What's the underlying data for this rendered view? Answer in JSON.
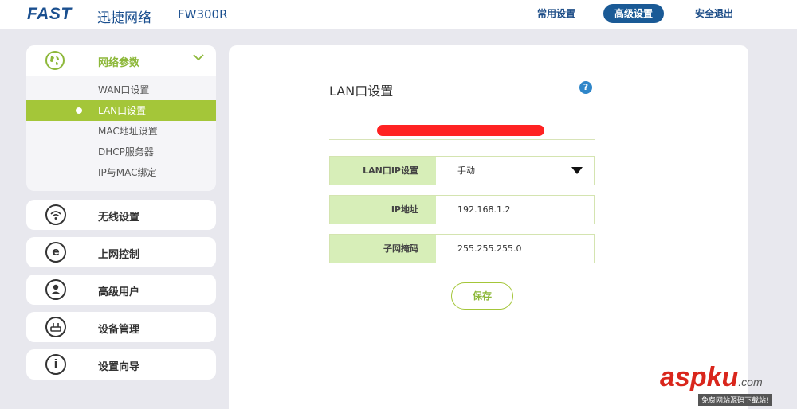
{
  "header": {
    "logo": "FAST",
    "brand": "迅捷网络",
    "model": "FW300R",
    "nav": {
      "common": "常用设置",
      "advanced": "高级设置",
      "logout": "安全退出"
    }
  },
  "sidebar": {
    "group": {
      "label": "网络参数",
      "items": [
        {
          "label": "WAN口设置"
        },
        {
          "label": "LAN口设置"
        },
        {
          "label": "MAC地址设置"
        },
        {
          "label": "DHCP服务器"
        },
        {
          "label": "IP与MAC绑定"
        }
      ],
      "active_index": 1
    },
    "menu": [
      {
        "label": "无线设置",
        "icon": "wifi-icon"
      },
      {
        "label": "上网控制",
        "icon": "internet-icon"
      },
      {
        "label": "高级用户",
        "icon": "user-icon"
      },
      {
        "label": "设备管理",
        "icon": "router-icon"
      },
      {
        "label": "设置向导",
        "icon": "info-icon"
      }
    ]
  },
  "main": {
    "title": "LAN口设置",
    "help": "?",
    "form": {
      "mode": {
        "label": "LAN口IP设置",
        "value": "手动"
      },
      "ip": {
        "label": "IP地址",
        "value": "192.168.1.2"
      },
      "mask": {
        "label": "子网掩码",
        "value": "255.255.255.0"
      }
    },
    "save_label": "保存"
  },
  "watermark": {
    "main": "asp",
    "main2": "ku",
    "domain": ".com",
    "sub": "免费网站源码下载站!"
  },
  "colors": {
    "accent_green": "#a4c639",
    "nav_blue": "#1a5a96",
    "label_bg": "#d7eeb8"
  }
}
